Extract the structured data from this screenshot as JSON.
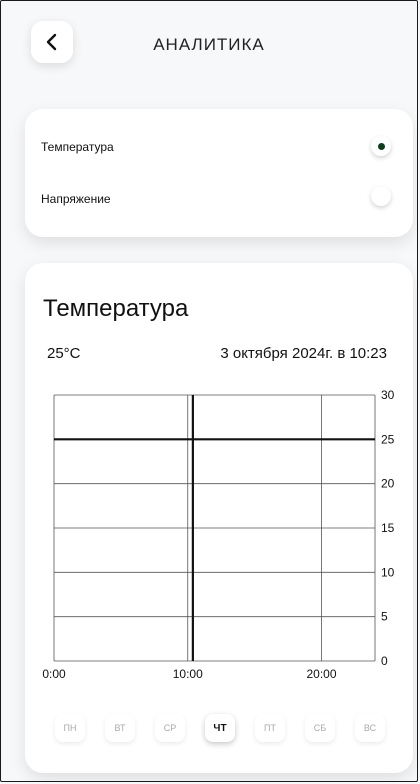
{
  "header": {
    "back_icon": "chevron-left-icon",
    "title": "АНАЛИТИКА"
  },
  "options": [
    {
      "label": "Температура",
      "selected": true
    },
    {
      "label": "Напряжение",
      "selected": false
    }
  ],
  "chart_card": {
    "title": "Температура",
    "current_value": "25°C",
    "current_date": "3 октября 2024г. в 10:23"
  },
  "chart_data": {
    "type": "line",
    "title": "Температура",
    "x_ticks": [
      "0:00",
      "10:00",
      "20:00"
    ],
    "y_ticks": [
      0,
      5,
      10,
      15,
      20,
      25,
      30
    ],
    "ylim": [
      0,
      30
    ],
    "x_range_hours": [
      0,
      24
    ],
    "grid": true,
    "value_line": 25,
    "marker_time": "10:23"
  },
  "days": [
    {
      "label": "ПН",
      "active": false
    },
    {
      "label": "ВТ",
      "active": false
    },
    {
      "label": "СР",
      "active": false
    },
    {
      "label": "ЧТ",
      "active": true
    },
    {
      "label": "ПТ",
      "active": false
    },
    {
      "label": "СБ",
      "active": false
    },
    {
      "label": "ВС",
      "active": false
    }
  ],
  "colors": {
    "selected_dot": "#0e3d1e",
    "line": "#111111"
  }
}
